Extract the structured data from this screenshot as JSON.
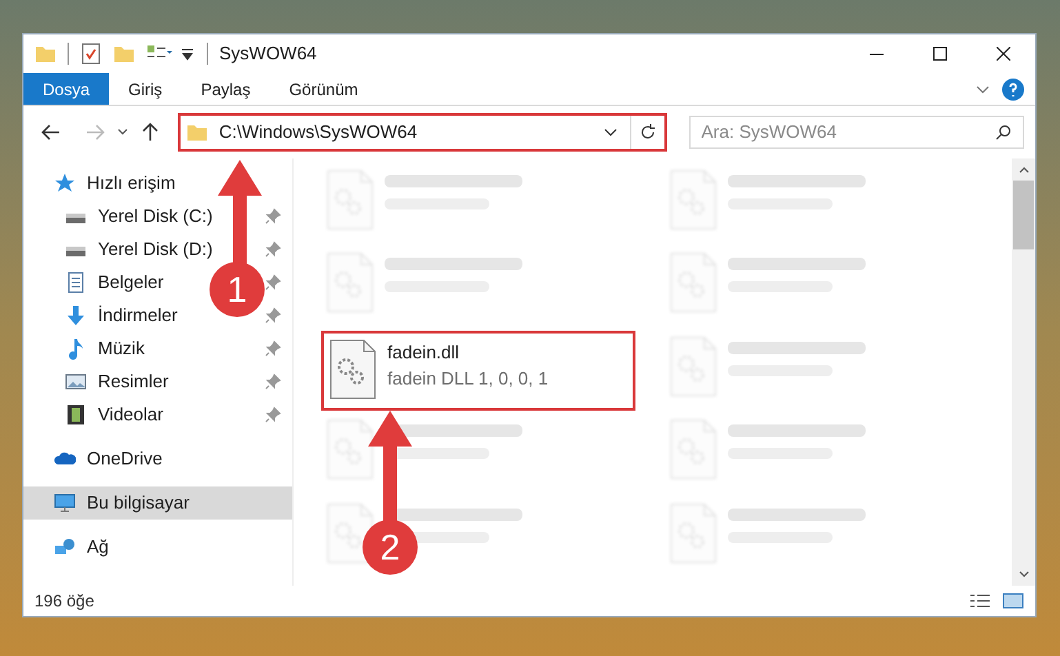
{
  "window": {
    "title": "SysWOW64"
  },
  "ribbon_tabs": [
    {
      "label": "Dosya",
      "selected": true
    },
    {
      "label": "Giriş",
      "selected": false
    },
    {
      "label": "Paylaş",
      "selected": false
    },
    {
      "label": "Görünüm",
      "selected": false
    }
  ],
  "address_bar": {
    "path": "C:\\Windows\\SysWOW64",
    "highlighted": true
  },
  "search": {
    "placeholder": "Ara: SysWOW64"
  },
  "navigation": [
    {
      "label": "Hızlı erişim",
      "kind": "star",
      "selected": false,
      "children": [
        {
          "label": "Yerel Disk (C:)",
          "kind": "drive",
          "pinned": true,
          "selected": false
        },
        {
          "label": "Yerel Disk (D:)",
          "kind": "drive",
          "pinned": true,
          "selected": false
        },
        {
          "label": "Belgeler",
          "kind": "documents",
          "pinned": true,
          "selected": false
        },
        {
          "label": "İndirmeler",
          "kind": "download",
          "pinned": true,
          "selected": false
        },
        {
          "label": "Müzik",
          "kind": "music",
          "pinned": true,
          "selected": false
        },
        {
          "label": "Resimler",
          "kind": "pictures",
          "pinned": true,
          "selected": false
        },
        {
          "label": "Videolar",
          "kind": "videos",
          "pinned": true,
          "selected": false
        }
      ]
    },
    {
      "label": "OneDrive",
      "kind": "cloud",
      "selected": false
    },
    {
      "label": "Bu bilgisayar",
      "kind": "computer",
      "selected": true
    },
    {
      "label": "Ağ",
      "kind": "network",
      "selected": false
    }
  ],
  "files": [
    {
      "blurred": true,
      "highlighted": false
    },
    {
      "blurred": true,
      "highlighted": false
    },
    {
      "blurred": true,
      "highlighted": false
    },
    {
      "blurred": true,
      "highlighted": false
    },
    {
      "name": "fadein.dll",
      "description": "fadein DLL 1, 0, 0, 1",
      "blurred": false,
      "highlighted": true
    },
    {
      "blurred": true,
      "highlighted": false
    },
    {
      "blurred": true,
      "highlighted": false
    },
    {
      "blurred": true,
      "highlighted": false
    },
    {
      "blurred": true,
      "highlighted": false
    },
    {
      "blurred": true,
      "highlighted": false
    }
  ],
  "status_bar": {
    "item_count": "196 öğe"
  },
  "annotations": [
    {
      "label": "1"
    },
    {
      "label": "2"
    }
  ]
}
